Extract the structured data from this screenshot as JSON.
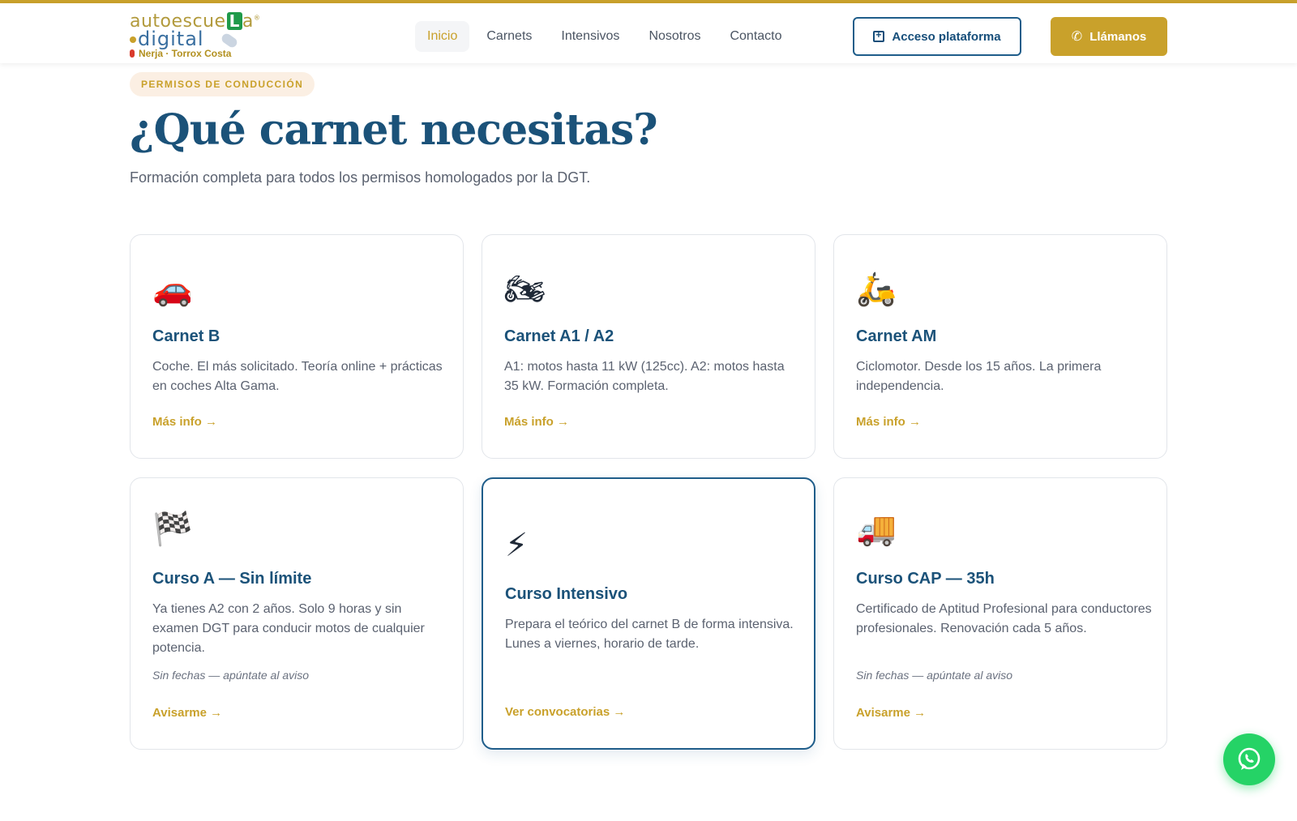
{
  "header": {
    "logo": {
      "line1": "autoescue",
      "line1_badge": "L",
      "line1_end": "a",
      "registered": "®",
      "line2": "digital",
      "location": "Nerja · Torrox Costa"
    },
    "nav": [
      {
        "label": "Inicio",
        "active": true
      },
      {
        "label": "Carnets",
        "active": false
      },
      {
        "label": "Intensivos",
        "active": false
      },
      {
        "label": "Nosotros",
        "active": false
      },
      {
        "label": "Contacto",
        "active": false
      }
    ],
    "access_button": "Acceso plataforma",
    "call_button": "Llámanos"
  },
  "section": {
    "badge": "PERMISOS DE CONDUCCIÓN",
    "title": "¿Qué carnet necesitas?",
    "subtitle": "Formación completa para todos los permisos homologados por la DGT."
  },
  "cards": [
    {
      "icon": "🚗",
      "icon_name": "car-icon",
      "title": "Carnet B",
      "desc": "Coche. El más solicitado. Teoría online + prácticas en coches Alta Gama.",
      "note": "",
      "link": "Más info →"
    },
    {
      "icon": "🏍",
      "icon_name": "motorcycle-icon",
      "title": "Carnet A1 / A2",
      "desc": "A1: motos hasta 11 kW (125cc). A2: motos hasta 35 kW. Formación completa.",
      "note": "",
      "link": "Más info →"
    },
    {
      "icon": "🛵",
      "icon_name": "scooter-icon",
      "title": "Carnet AM",
      "desc": "Ciclomotor. Desde los 15 años. La primera independencia.",
      "note": "",
      "link": "Más info →"
    },
    {
      "icon": "🏁",
      "icon_name": "checkered-flag-icon",
      "title": "Curso A — Sin límite",
      "desc": "Ya tienes A2 con 2 años. Solo 9 horas y sin examen DGT para conducir motos de cualquier potencia.",
      "note": "Sin fechas — apúntate al aviso",
      "link": "Avisarme →"
    },
    {
      "icon": "⚡",
      "icon_name": "lightning-icon",
      "title": "Curso Intensivo",
      "desc": "Prepara el teórico del carnet B de forma intensiva. Lunes a viernes, horario de tarde.",
      "note": "",
      "link": "Ver convocatorias →"
    },
    {
      "icon": "🚚",
      "icon_name": "truck-icon",
      "title": "Curso CAP — 35h",
      "desc": "Certificado de Aptitud Profesional para conductores profesionales. Renovación cada 5 años.",
      "note": "Sin fechas — apúntate al aviso",
      "link": "Avisarme →"
    }
  ],
  "colors": {
    "gold": "#c9a12b",
    "navy": "#1b5279",
    "whatsapp": "#25d366"
  }
}
